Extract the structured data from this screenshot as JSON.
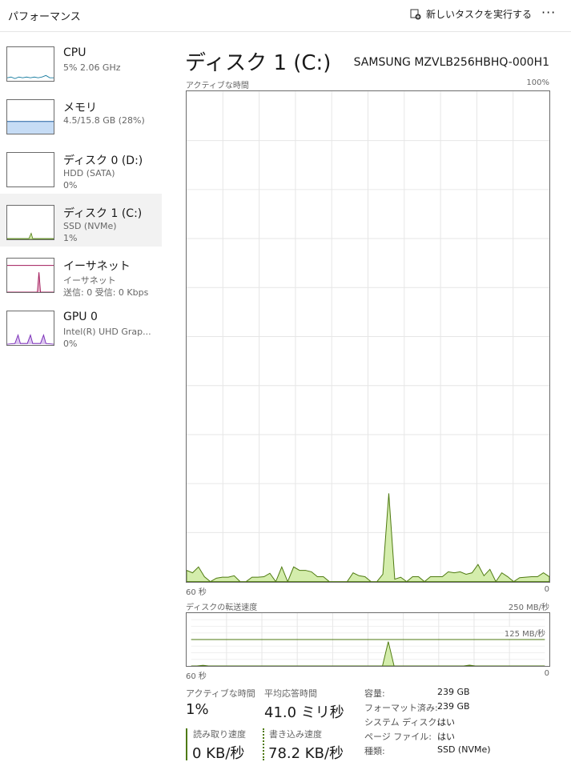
{
  "header": {
    "title": "パフォーマンス",
    "run_task": "新しいタスクを実行する",
    "more": "···"
  },
  "sidebar": [
    {
      "name": "CPU",
      "sub1": "5%  2.06 GHz",
      "sub2": "",
      "color": "#1b7ea1"
    },
    {
      "name": "メモリ",
      "sub1": "4.5/15.8 GB (28%)",
      "sub2": "",
      "color": "#1e5fa0"
    },
    {
      "name": "ディスク 0 (D:)",
      "sub1": "HDD (SATA)",
      "sub2": "0%",
      "color": "#4e7a10"
    },
    {
      "name": "ディスク 1 (C:)",
      "sub1": "SSD (NVMe)",
      "sub2": "1%",
      "color": "#4e7a10"
    },
    {
      "name": "イーサネット",
      "sub1": "イーサネット",
      "sub2": "送信: 0 受信: 0 Kbps",
      "color": "#a1195a"
    },
    {
      "name": "GPU 0",
      "sub1": "Intel(R) UHD Grap...",
      "sub2": "0%",
      "color": "#7b2fb8"
    }
  ],
  "main": {
    "title": "ディスク 1 (C:)",
    "model": "SAMSUNG MZVLB256HBHQ-000H1"
  },
  "chart_data": [
    {
      "type": "area",
      "title": "アクティブな時間",
      "ymax_label": "100%",
      "ylim": [
        0,
        100
      ],
      "x_left": "60 秒",
      "x_right": "0",
      "values": [
        2.3,
        1.8,
        3,
        1,
        0,
        0.7,
        0.9,
        0.9,
        1.2,
        0,
        0,
        0.9,
        0.9,
        1,
        1.7,
        0,
        3,
        0,
        3,
        2.3,
        2.3,
        2,
        1,
        1,
        0,
        0,
        0,
        0,
        1.8,
        1.2,
        1,
        0,
        0,
        1.5,
        18,
        0.5,
        0.9,
        0,
        1,
        1,
        0,
        1,
        1,
        1,
        2,
        1.8,
        2,
        1.5,
        1.8,
        3.5,
        1.2,
        2.5,
        0,
        1.8,
        1,
        0,
        0.8,
        0.9,
        1,
        1,
        1.8,
        1
      ]
    },
    {
      "type": "area",
      "title": "ディスクの転送速度",
      "ymax_label": "250 MB/秒",
      "ref_label": "125 MB/秒",
      "ref_value": 125,
      "ylim": [
        0,
        250
      ],
      "x_left": "60 秒",
      "x_right": "0",
      "values": [
        0,
        0,
        3,
        0,
        0,
        0,
        0,
        0,
        0,
        0,
        0,
        0,
        0,
        0,
        0,
        0,
        0,
        0,
        0,
        0,
        0,
        0,
        0,
        0,
        0,
        0,
        0,
        0,
        0,
        0,
        0,
        0,
        0,
        0,
        115,
        0,
        0,
        0,
        0,
        0,
        0,
        0,
        0,
        0,
        0,
        0,
        0,
        0,
        4,
        0,
        0,
        0,
        0,
        0,
        0,
        0,
        0,
        0,
        0,
        0,
        0,
        0
      ]
    }
  ],
  "stats": {
    "active_label": "アクティブな時間",
    "active_value": "1%",
    "resp_label": "平均応答時間",
    "resp_value": "41.0 ミリ秒",
    "read_label": "読み取り速度",
    "read_value": "0 KB/秒",
    "write_label": "書き込み速度",
    "write_value": "78.2 KB/秒"
  },
  "props": [
    {
      "k": "容量:",
      "v": "239 GB"
    },
    {
      "k": "フォーマット済み:",
      "v": "239 GB"
    },
    {
      "k": "システム ディスク:",
      "v": "はい"
    },
    {
      "k": "ページ ファイル:",
      "v": "はい"
    },
    {
      "k": "種類:",
      "v": "SSD (NVMe)"
    }
  ]
}
